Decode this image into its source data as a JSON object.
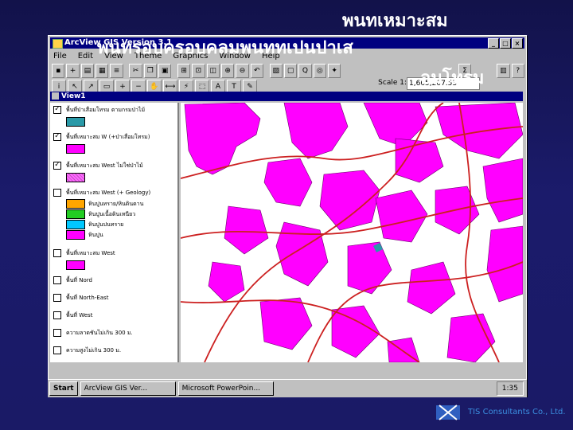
{
  "slide": {
    "title_line1": "พนทเหมาะสม",
    "title_line2": "พนทรอบครอบคลมพนททเปนปาเส",
    "title_line3": "อมโทรม",
    "footer": "TIS Consultants Co., Ltd."
  },
  "app": {
    "title": "ArcView GIS Version 3.1",
    "menu": [
      "File",
      "Edit",
      "View",
      "Theme",
      "Graphics",
      "Window",
      "Help"
    ],
    "scale_label": "Scale 1:",
    "scale_value": "1,665,207.53",
    "coords": "1,665,207.53",
    "view_title": "View1"
  },
  "toc": {
    "themes": [
      {
        "label": "พื้นที่ป่าเสื่อมโทรม ตามกรมป่าไม้",
        "checked": true,
        "swatch": "#2a9aa8"
      },
      {
        "label": "พื้นที่เหมาะสม W (+ป่าเสื่อมโทรม)",
        "checked": true,
        "swatch": "#ff00ff"
      },
      {
        "label": "พื้นที่เหมาะสม West ไม่ใช่ป่าไม้",
        "checked": true,
        "swatch": "#ff66ff"
      },
      {
        "label": "พื้นที่เหมาะสม West (+ Geology)",
        "checked": false
      },
      {
        "label": "พื้นที่เหมาะสม West",
        "checked": false,
        "swatch": "#ff00ff"
      },
      {
        "label": "พื้นที่ Nord",
        "checked": false
      },
      {
        "label": "พื้นที่ North-East",
        "checked": false
      },
      {
        "label": "พื้นที่ West",
        "checked": false
      },
      {
        "label": "ความลาดชันไม่เกิน 300 ม.",
        "checked": false
      },
      {
        "label": "ความสูงไม่เกิน 300 ม.",
        "checked": false
      }
    ],
    "legend": [
      {
        "label": "หินปูนทราย/หินดินดาน",
        "color": "#ffa500"
      },
      {
        "label": "หินปูนเนื้อดินเหนียว",
        "color": "#22cc22"
      },
      {
        "label": "หินปูนปนทราย",
        "color": "#00c8ff"
      },
      {
        "label": "หินปูน",
        "color": "#ff00ff"
      }
    ]
  },
  "taskbar": {
    "start": "Start",
    "items": [
      "ArcView GIS Ver...",
      "Microsoft PowerPoin..."
    ],
    "clock": "1:35"
  },
  "colors": {
    "accent": "#000080",
    "polygon": "#ff00ff",
    "road": "#cc2020",
    "teal": "#2a9aa8"
  }
}
